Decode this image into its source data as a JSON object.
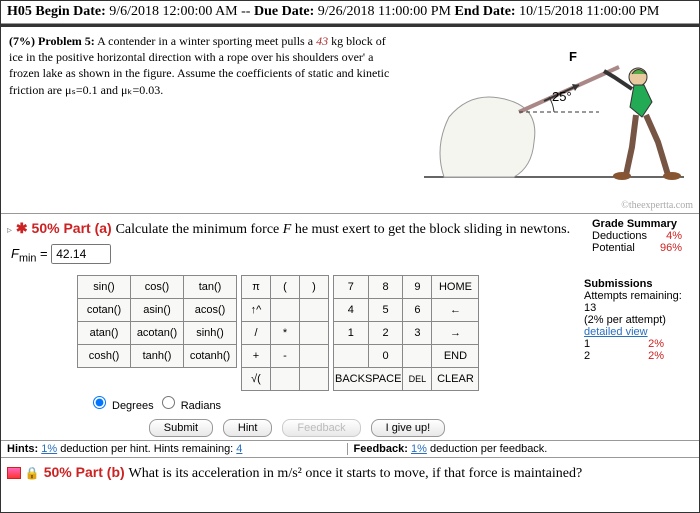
{
  "header": {
    "hw": "H05",
    "begin_label": "Begin Date:",
    "begin": "9/6/2018 12:00:00 AM",
    "sep": "--",
    "due_label": "Due Date:",
    "due": "9/26/2018 11:00:00 PM",
    "end_label": "End Date:",
    "end": "10/15/2018 11:00:00 PM"
  },
  "problem": {
    "pct": "(7%)",
    "label": "Problem 5:",
    "text_pre": "A contender in a winter sporting meet pulls a ",
    "mass": "43",
    "text_post": " kg block of ice in the positive horizontal direction with a rope over his shoulders over' a frozen lake as shown in the figure. Assume the coefficients of static and kinetic friction are μₛ=0.1 and μₖ=0.03.",
    "angle_label": "25°",
    "force_label": "F",
    "watermark": "©theexpertta.com"
  },
  "part_a": {
    "arrow": "▹",
    "star": "✱",
    "pct": "50%",
    "label": "Part (a)",
    "prompt_pre": "Calculate the minimum force ",
    "prompt_var": "F",
    "prompt_post": " he must exert to get the block sliding in newtons.",
    "var": "F",
    "sub": "min",
    "eq": "=",
    "value": "42.14"
  },
  "grade": {
    "title": "Grade Summary",
    "ded_label": "Deductions",
    "ded_val": "4%",
    "pot_label": "Potential",
    "pot_val": "96%"
  },
  "subs": {
    "title": "Submissions",
    "rem": "Attempts remaining: 13",
    "per": "(2% per attempt)",
    "dv": "detailed view",
    "a1": "1",
    "a1v": "2%",
    "a2": "2",
    "a2v": "2%"
  },
  "calc": {
    "fns": [
      [
        "sin()",
        "cos()",
        "tan()"
      ],
      [
        "cotan()",
        "asin()",
        "acos()"
      ],
      [
        "atan()",
        "acotan()",
        "sinh()"
      ],
      [
        "cosh()",
        "tanh()",
        "cotanh()"
      ]
    ],
    "ops1": [
      "π",
      "(",
      ")"
    ],
    "ops2": [
      "↑^",
      "",
      ""
    ],
    "ops3": [
      "/",
      "*",
      ""
    ],
    "ops4": [
      "+",
      "-",
      ""
    ],
    "ops5": [
      "√(",
      "",
      ""
    ],
    "kp": [
      [
        "7",
        "8",
        "9",
        "HOME"
      ],
      [
        "4",
        "5",
        "6",
        "←"
      ],
      [
        "1",
        "2",
        "3",
        "→"
      ],
      [
        "",
        "0",
        "",
        "END"
      ],
      [
        "BACKSPACE",
        "DEL",
        "CLEAR"
      ]
    ],
    "deg": "Degrees",
    "rad": "Radians"
  },
  "actions": {
    "submit": "Submit",
    "hint": "Hint",
    "fb": "Feedback",
    "giveup": "I give up!"
  },
  "footer": {
    "hints_label": "Hints:",
    "hints_cost": "1%",
    "hints_text": " deduction per hint. Hints remaining: ",
    "hints_rem": "4",
    "fb_label": "Feedback:",
    "fb_cost": "1%",
    "fb_text": " deduction per feedback."
  },
  "part_b": {
    "pct": "50%",
    "label": "Part (b)",
    "prompt": "What is its acceleration in m/s² once it starts to move, if that force is maintained?"
  }
}
